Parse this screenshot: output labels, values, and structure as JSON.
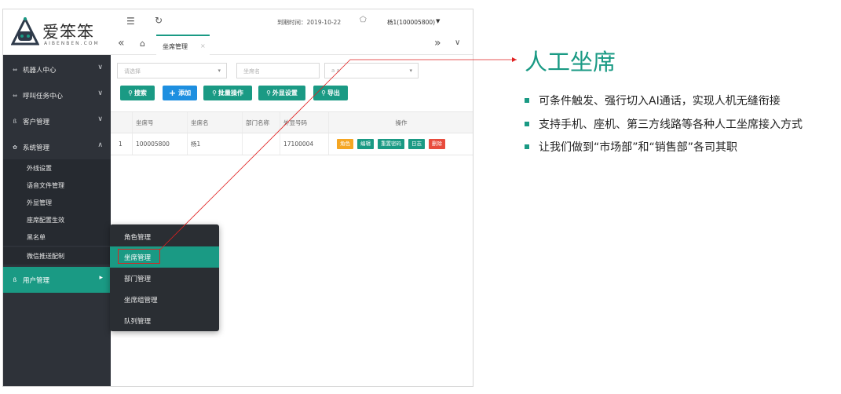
{
  "logo": {
    "title": "爱笨笨",
    "subtitle": "AIBENBEN.COM"
  },
  "topbar": {
    "menu_icon": "menu-fold-icon",
    "refresh_icon": "refresh-icon",
    "expire_label": "到期时间：2019-10-22",
    "tag_icon": "tag-icon",
    "user": "杨1(100005800)",
    "user_caret": "▼"
  },
  "tabbar": {
    "prev": "«",
    "home_icon": "home-icon",
    "tab_label": "坐席管理",
    "tab_close": "×",
    "next": "»",
    "more": "∨"
  },
  "sidebar": {
    "items": [
      {
        "label": "机器人中心",
        "icon": "robot-icon",
        "chev": "∨"
      },
      {
        "label": "呼叫任务中心",
        "icon": "task-icon",
        "chev": "∨"
      },
      {
        "label": "客户管理",
        "icon": "customer-icon",
        "chev": "∨"
      },
      {
        "label": "系统管理",
        "icon": "gear-icon",
        "chev": "∧"
      },
      {
        "label": "用户管理",
        "icon": "user-icon",
        "chev": "▸"
      }
    ],
    "sub_items": [
      "外线设置",
      "语音文件管理",
      "外显管理",
      "座席配置生效",
      "黑名单",
      "微信推送配制"
    ]
  },
  "filters": {
    "select1": "请选择",
    "input1": "坐席名",
    "select2": "a a",
    "caret": "▾"
  },
  "buttons": {
    "search": "搜索",
    "add": "添加",
    "batch": "批量操作",
    "display": "外显设置",
    "export": "导出",
    "search_icon": "magnifier-icon",
    "add_icon": "plus-icon"
  },
  "table": {
    "headers": [
      "",
      "坐席号",
      "坐席名",
      "部门名称",
      "外显号码",
      "操作"
    ],
    "rows": [
      {
        "index": "1",
        "seat_no": "100005800",
        "seat_name": "杨1",
        "dept": "",
        "display_no": "17100004"
      }
    ],
    "actions": [
      {
        "label": "角色",
        "color": "#f5a623"
      },
      {
        "label": "编辑",
        "color": "#1a9a84"
      },
      {
        "label": "重置密码",
        "color": "#1a9a84"
      },
      {
        "label": "日志",
        "color": "#1a9a84"
      },
      {
        "label": "删除",
        "color": "#e84c3d"
      }
    ]
  },
  "popup": {
    "items": [
      "角色管理",
      "坐席管理",
      "部门管理",
      "坐席组管理",
      "队列管理"
    ],
    "active": "坐席管理"
  },
  "panel": {
    "title": "人工坐席",
    "bullets": [
      "可条件触发、强行切入AI通话，实现人机无缝衔接",
      "支持手机、座机、第三方线路等各种人工坐席接入方式",
      "让我们做到“市场部”和“销售部”各司其职"
    ]
  },
  "colors": {
    "accent": "#1a9a84",
    "sidebar": "#2e3239",
    "danger": "#e84c3d",
    "warning": "#f5a623",
    "primary": "#1e8fe0",
    "pointer": "#e02020"
  }
}
